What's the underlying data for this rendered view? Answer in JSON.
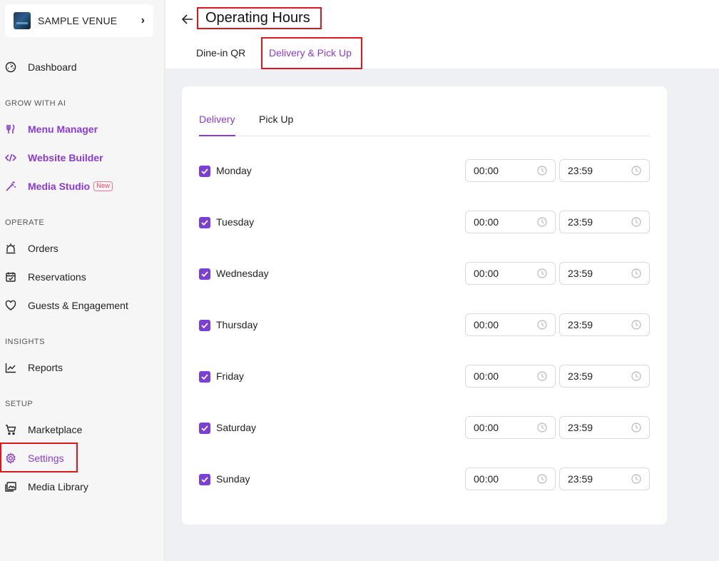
{
  "venue": {
    "name": "SAMPLE VENUE",
    "chevron": "›"
  },
  "sidebar": {
    "dashboard": "Dashboard",
    "grow_label": "GROW WITH AI",
    "menu_manager": "Menu Manager",
    "website_builder": "Website Builder",
    "media_studio": "Media Studio",
    "media_studio_badge": "New",
    "operate_label": "OPERATE",
    "orders": "Orders",
    "reservations": "Reservations",
    "guests": "Guests & Engagement",
    "insights_label": "INSIGHTS",
    "reports": "Reports",
    "setup_label": "SETUP",
    "marketplace": "Marketplace",
    "settings": "Settings",
    "media_library": "Media Library"
  },
  "header": {
    "title": "Operating Hours",
    "tabs": [
      "Dine-in QR",
      "Delivery & Pick Up"
    ]
  },
  "subtabs": [
    "Delivery",
    "Pick Up"
  ],
  "days": [
    {
      "name": "Monday",
      "from": "00:00",
      "to": "23:59",
      "checked": true
    },
    {
      "name": "Tuesday",
      "from": "00:00",
      "to": "23:59",
      "checked": true
    },
    {
      "name": "Wednesday",
      "from": "00:00",
      "to": "23:59",
      "checked": true
    },
    {
      "name": "Thursday",
      "from": "00:00",
      "to": "23:59",
      "checked": true
    },
    {
      "name": "Friday",
      "from": "00:00",
      "to": "23:59",
      "checked": true
    },
    {
      "name": "Saturday",
      "from": "00:00",
      "to": "23:59",
      "checked": true
    },
    {
      "name": "Sunday",
      "from": "00:00",
      "to": "23:59",
      "checked": true
    }
  ],
  "colors": {
    "accent": "#8a3ad6",
    "checkbox": "#7b3fd6",
    "highlight": "#e0161c"
  }
}
